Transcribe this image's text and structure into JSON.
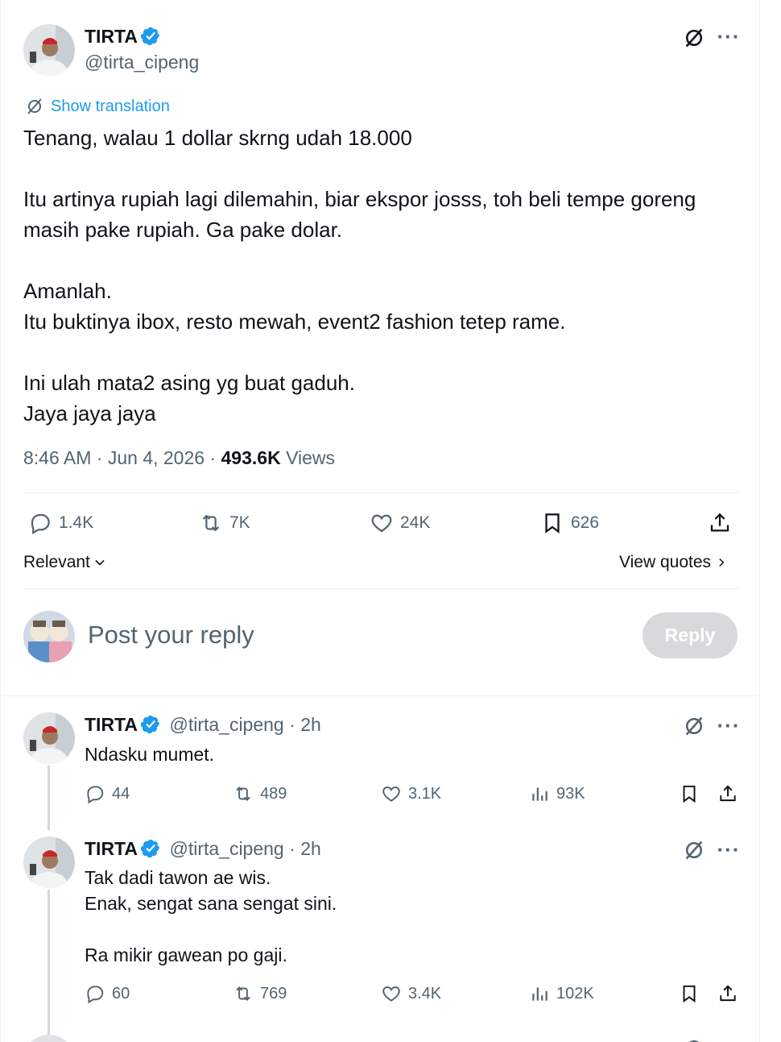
{
  "main_tweet": {
    "name": "TIRTA",
    "handle": "@tirta_cipeng",
    "show_translation": "Show translation",
    "lines": [
      "Tenang, walau 1 dollar skrng udah 18.000",
      "",
      "Itu artinya rupiah lagi dilemahin, biar ekspor josss, toh beli tempe goreng",
      "masih pake rupiah. Ga pake dolar.",
      "",
      "Amanlah.",
      "Itu buktinya ibox, resto mewah, event2 fashion tetep rame.",
      "",
      "Ini ulah mata2 asing yg buat gaduh.",
      "Jaya jaya jaya"
    ],
    "time": "8:46 AM",
    "date": "Jun 4, 2026",
    "views_count": "493.6K",
    "views_label": "Views",
    "replies": "1.4K",
    "reposts": "7K",
    "likes": "24K",
    "bookmarks": "626"
  },
  "sort": {
    "label": "Relevant",
    "view_quotes": "View quotes"
  },
  "composer": {
    "placeholder": "Post your reply",
    "button": "Reply"
  },
  "replies": [
    {
      "name": "TIRTA",
      "handle": "@tirta_cipeng",
      "time": "2h",
      "lines": [
        "Ndasku mumet."
      ],
      "replies": "44",
      "reposts": "489",
      "likes": "3.1K",
      "views": "93K"
    },
    {
      "name": "TIRTA",
      "handle": "@tirta_cipeng",
      "time": "2h",
      "lines": [
        "Tak dadi tawon ae wis.",
        "Enak, sengat sana sengat sini.",
        "",
        "Ra mikir gawean po gaji."
      ],
      "replies": "60",
      "reposts": "769",
      "likes": "3.4K",
      "views": "102K"
    }
  ],
  "colors": {
    "accent": "#1d9bf0",
    "muted": "#536471",
    "text": "#0f1419",
    "reply_disabled": "#d7d9db"
  }
}
